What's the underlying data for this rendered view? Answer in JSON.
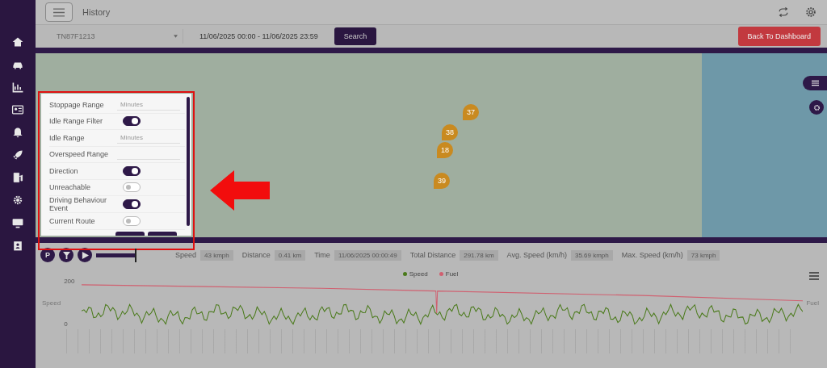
{
  "header": {
    "title": "History"
  },
  "filters": {
    "vehicle": "TN87F1213",
    "date_range": "11/06/2025 00:00 - 11/06/2025 23:59",
    "search_button": "Search",
    "back_button": "Back To Dashboard"
  },
  "map": {
    "markers": [
      "37",
      "38",
      "18",
      "39"
    ]
  },
  "settings_panel": {
    "items": [
      {
        "kind": "number",
        "label": "Stoppage Range",
        "placeholder": "Minutes"
      },
      {
        "kind": "toggle",
        "label": "Idle Range Filter",
        "on": true
      },
      {
        "kind": "number",
        "label": "Idle Range",
        "placeholder": "Minutes"
      },
      {
        "kind": "number",
        "label": "Overspeed Range"
      },
      {
        "kind": "toggle",
        "label": "Direction",
        "on": true
      },
      {
        "kind": "toggle",
        "label": "Unreachable",
        "on": false
      },
      {
        "kind": "toggle",
        "label": "Driving Behaviour Event",
        "on": true
      },
      {
        "kind": "toggle",
        "label": "Current Route",
        "on": false
      }
    ]
  },
  "playback": {
    "parking_button": "P",
    "progress": {
      "level": 1
    }
  },
  "stats": [
    {
      "label": "Speed",
      "value": "43 kmph"
    },
    {
      "label": "Distance",
      "value": "0.41 km"
    },
    {
      "label": "Time",
      "value": "11/06/2025 00:00:49"
    },
    {
      "label": "Total Distance",
      "value": "291.78 km"
    },
    {
      "label": "Avg. Speed (km/h)",
      "value": "35.69 kmph"
    },
    {
      "label": "Max. Speed (km/h)",
      "value": "73 kmph"
    }
  ],
  "chart": {
    "legend": [
      "Speed",
      "Fuel"
    ],
    "y_axis_title": "Speed",
    "y2_axis_title": "Fuel",
    "y_ticks": [
      "200",
      "0"
    ]
  }
}
